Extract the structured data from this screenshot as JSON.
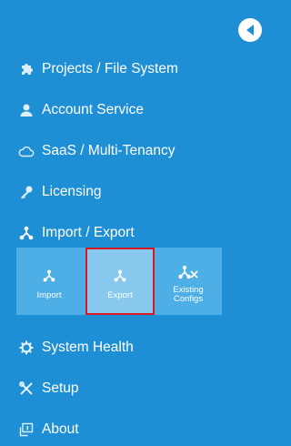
{
  "sidebar": {
    "collapse_button": {
      "icon": "chevron-left-icon"
    },
    "items": [
      {
        "label": "Projects / File System",
        "icon": "puzzle-icon"
      },
      {
        "label": "Account Service",
        "icon": "user-icon"
      },
      {
        "label": "SaaS / Multi-Tenancy",
        "icon": "cloud-icon"
      },
      {
        "label": "Licensing",
        "icon": "key-icon"
      },
      {
        "label": "Import / Export",
        "icon": "import-export-icon"
      },
      {
        "label": "System Health",
        "icon": "gear-icon"
      },
      {
        "label": "Setup",
        "icon": "tools-icon"
      },
      {
        "label": "About",
        "icon": "about-icon"
      }
    ],
    "subnav": {
      "tiles": [
        {
          "label": "Import",
          "icon": "import-icon"
        },
        {
          "label": "Export",
          "icon": "export-icon",
          "selected": true
        },
        {
          "label_line1": "Existing",
          "label_line2": "Configs",
          "icon": "existing-configs-icon"
        }
      ]
    }
  },
  "colors": {
    "background": "#1e8fd5",
    "subnav_background": "#4eaee6",
    "selected_tile": "#8ac9ef",
    "highlight_border": "#d71920",
    "text": "#ffffff"
  }
}
